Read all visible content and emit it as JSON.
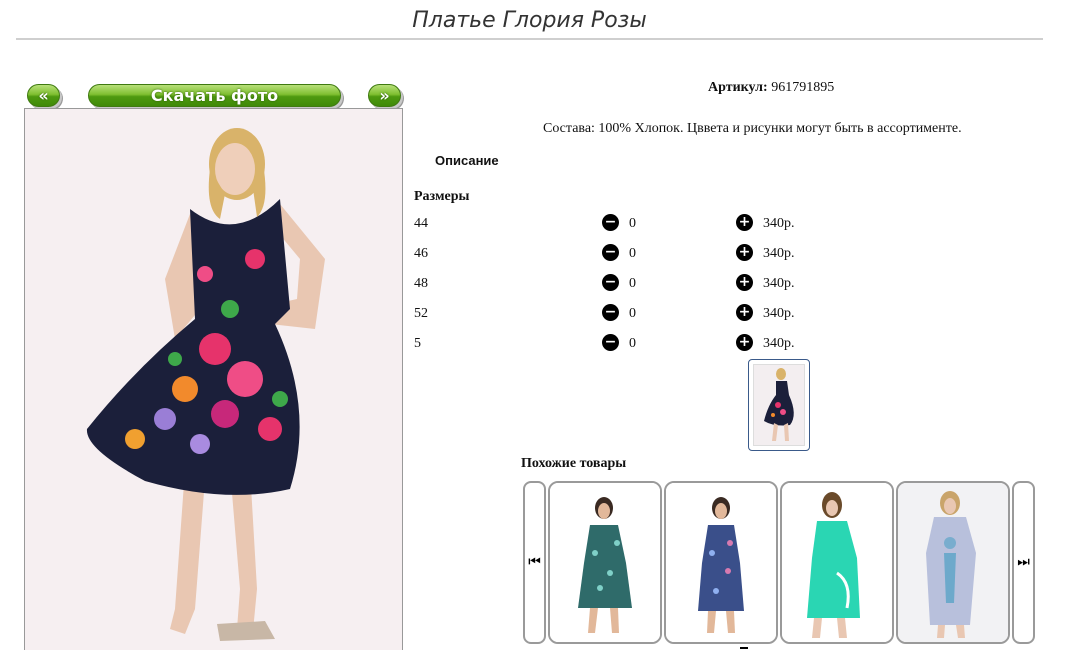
{
  "page": {
    "title": "Платье Глория Розы"
  },
  "gallery": {
    "prev_label": "«",
    "download_label": "Скачать фото",
    "next_label": "»"
  },
  "product": {
    "article_label": "Артикул:",
    "article_value": "961791895",
    "composition": "Состава: 100% Хлопок. Цввета и рисунки могут быть в ассортименте.",
    "description_tab": "Описание",
    "sizes_label": "Размеры"
  },
  "sizes": [
    {
      "size": "44",
      "qty": "0",
      "price": "340р."
    },
    {
      "size": "46",
      "qty": "0",
      "price": "340р."
    },
    {
      "size": "48",
      "qty": "0",
      "price": "340р."
    },
    {
      "size": "52",
      "qty": "0",
      "price": "340р."
    },
    {
      "size": "5",
      "qty": "0",
      "price": "340р."
    }
  ],
  "controls": {
    "minus_symbol": "−",
    "plus_symbol": "+"
  },
  "similar": {
    "title": "Похожие товары",
    "prev_arrow": "⏮",
    "next_arrow": "⏭"
  },
  "icons": {
    "minus": "minus-circle-icon",
    "plus": "plus-circle-icon",
    "prev": "skip-previous-icon",
    "next": "skip-next-icon"
  },
  "colors": {
    "button_green": "#5aa316",
    "dress_main": "#1b1f3a",
    "similar_1": "#2f6b6a",
    "similar_2": "#3a4f8a",
    "similar_3": "#2ad6b3",
    "similar_4": "#b8c0dc"
  }
}
